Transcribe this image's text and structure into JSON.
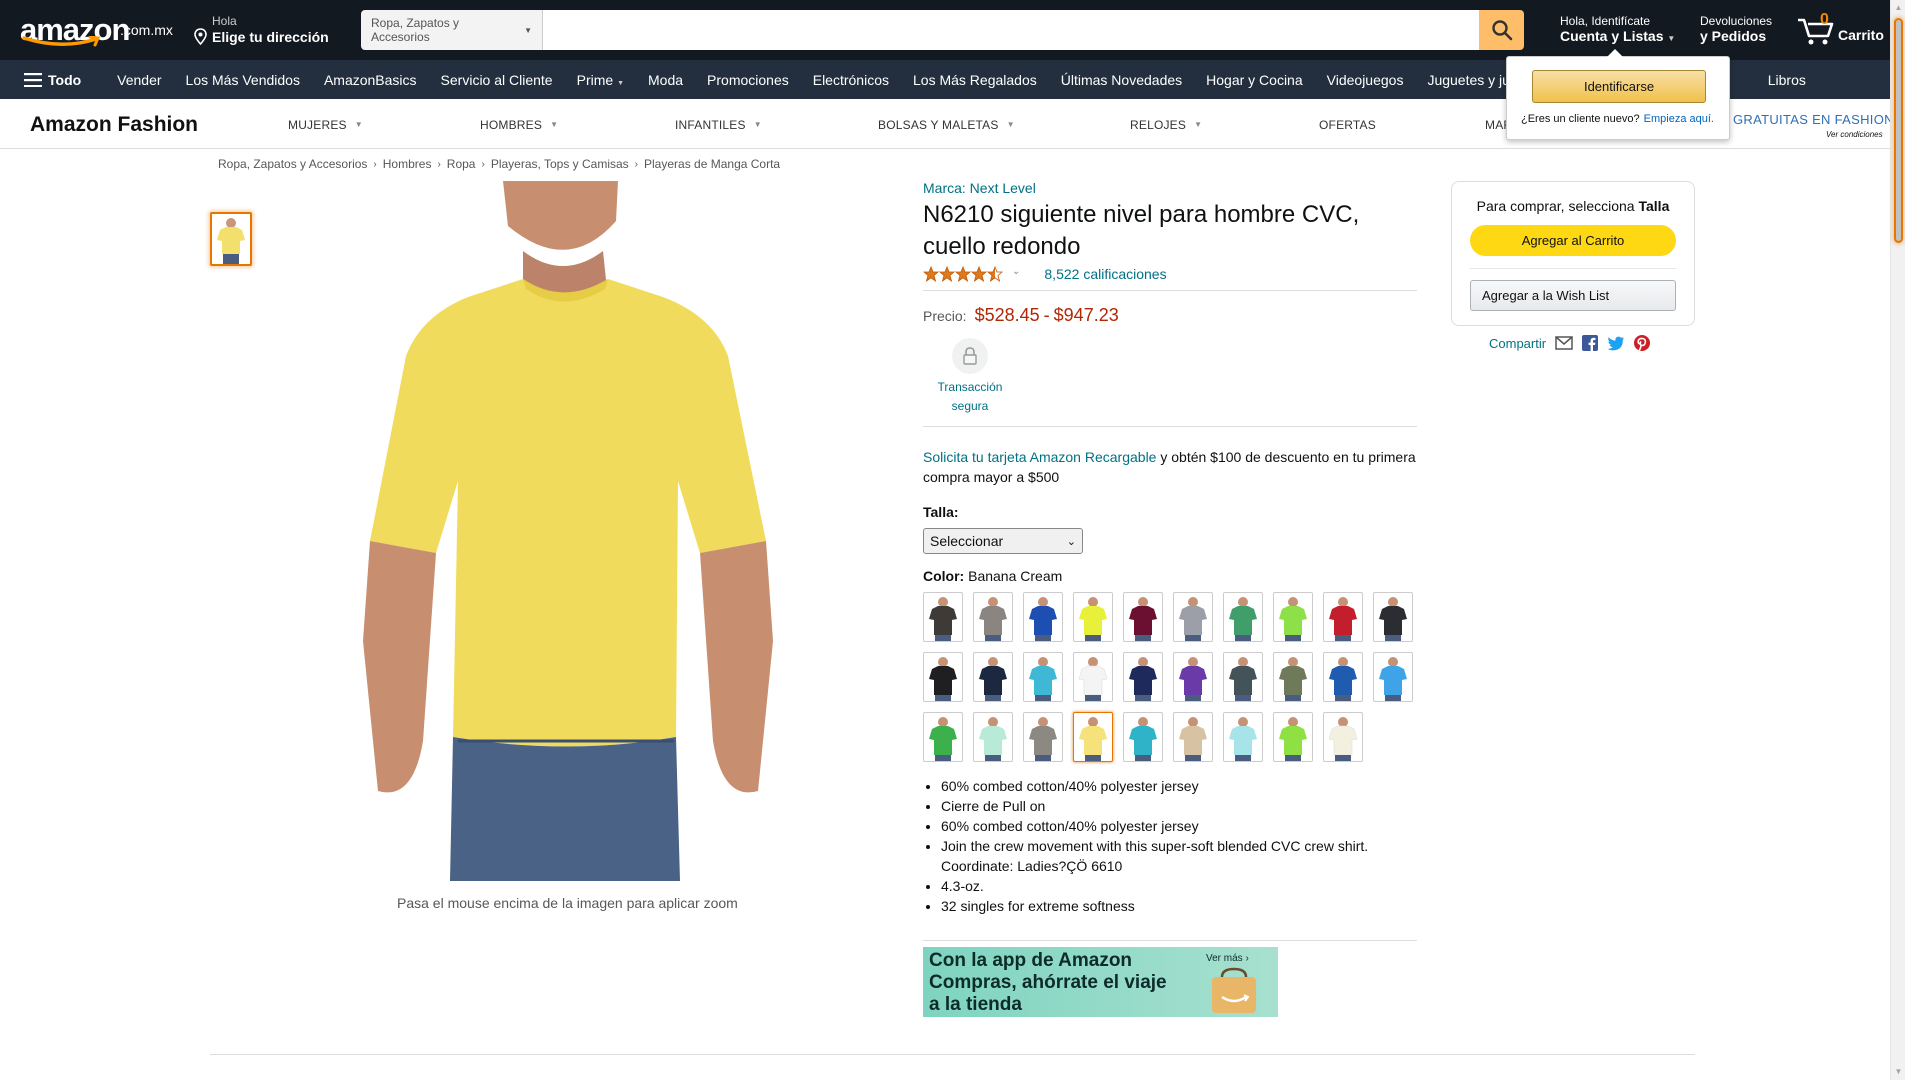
{
  "topnav": {
    "logo_text": "amazon",
    "logo_tld": ".com.mx",
    "deliver_l1": "Hola",
    "deliver_l2": "Elige tu dirección",
    "search_category": "Ropa, Zapatos y Accesorios",
    "search_placeholder": "",
    "account_l1": "Hola, Identifícate",
    "account_l2": "Cuenta y Listas",
    "orders_l1": "Devoluciones",
    "orders_l2": "y Pedidos",
    "cart_count": "0",
    "cart_label": "Carrito"
  },
  "subnav": {
    "todo": "Todo",
    "items": [
      "Vender",
      "Los Más Vendidos",
      "AmazonBasics",
      "Servicio al Cliente",
      "Prime",
      "Moda",
      "Promociones",
      "Electrónicos",
      "Los Más Regalados",
      "Últimas Novedades",
      "Hogar y Cocina",
      "Videojuegos",
      "Juguetes y jue",
      "Libros"
    ]
  },
  "fashion": {
    "brand": "Amazon Fashion",
    "categories": [
      "MUJERES",
      "HOMBRES",
      "INFANTILES",
      "BOLSAS Y MALETAS",
      "RELOJES",
      "OFERTAS",
      "MAR"
    ],
    "promo": "GRATUITAS EN FASHION",
    "promo_sub": "Ver condiciones"
  },
  "popup": {
    "button": "Identificarse",
    "text": "¿Eres un cliente nuevo?",
    "link": "Empieza aquí."
  },
  "breadcrumb": [
    "Ropa, Zapatos y Accesorios",
    "Hombres",
    "Ropa",
    "Playeras, Tops y Camisas",
    "Playeras de Manga Corta"
  ],
  "gallery": {
    "zoom_hint": "Pasa el mouse encima de la imagen para aplicar zoom"
  },
  "product": {
    "brand": "Marca: Next Level",
    "title": "N6210 siguiente nivel para hombre CVC, cuello redondo",
    "rating_count": "8,522 calificaciones",
    "rating": 4.5,
    "price_label": "Precio:",
    "price_low": "$528.45",
    "price_sep": "-",
    "price_high": "$947.23",
    "secure_text": "Transacción segura",
    "promo_link": "Solicita tu tarjeta Amazon Recargable",
    "promo_rest": " y obtén $100 de descuento en tu primera compra mayor a $500",
    "size_label": "Talla:",
    "size_value": "Seleccionar",
    "color_label": "Color:",
    "color_value": "Banana Cream",
    "swatches": [
      "#3d3a37",
      "#8a8580",
      "#1d4fb3",
      "#e8f03a",
      "#6b1031",
      "#9c9ea8",
      "#3f9e6a",
      "#8ee048",
      "#c21e2c",
      "#2c2d33",
      "#1f1f22",
      "#1c2840",
      "#3fb8d6",
      "#f4f4f4",
      "#1f2a5c",
      "#6a3aa8",
      "#44525a",
      "#6e7a5a",
      "#1f5cb0",
      "#3fa3e8",
      "#3bb04b",
      "#b7ead7",
      "#8c8882",
      "#f5e27a",
      "#2fb3c8",
      "#d7c3a3",
      "#a7e4ea",
      "#8fe043",
      "#f4f0e0"
    ],
    "selected_swatch": 23,
    "bullets": [
      "60% combed cotton/40% polyester jersey",
      "Cierre de Pull on",
      "60% combed cotton/40% polyester jersey",
      "Join the crew movement with this super-soft blended CVC crew shirt. Coordinate: Ladies?ÇÖ 6610",
      "4.3-oz.",
      "32 singles for extreme softness"
    ],
    "app_banner": "Con la app de Amazon Compras, ahórrate el viaje a la tienda",
    "app_banner_more": "Ver más ›"
  },
  "buybox": {
    "select_prefix": "Para comprar, selecciona",
    "select_bold": "Talla",
    "add_to_cart": "Agregar al Carrito",
    "wishlist": "Agregar a la Wish List",
    "share": "Compartir"
  },
  "colors": {
    "nav_dark": "#131921",
    "nav_sub": "#232f3e",
    "price": "#b12704",
    "link": "#007185",
    "cart_button": "#ffd814",
    "search_button": "#febd69"
  }
}
